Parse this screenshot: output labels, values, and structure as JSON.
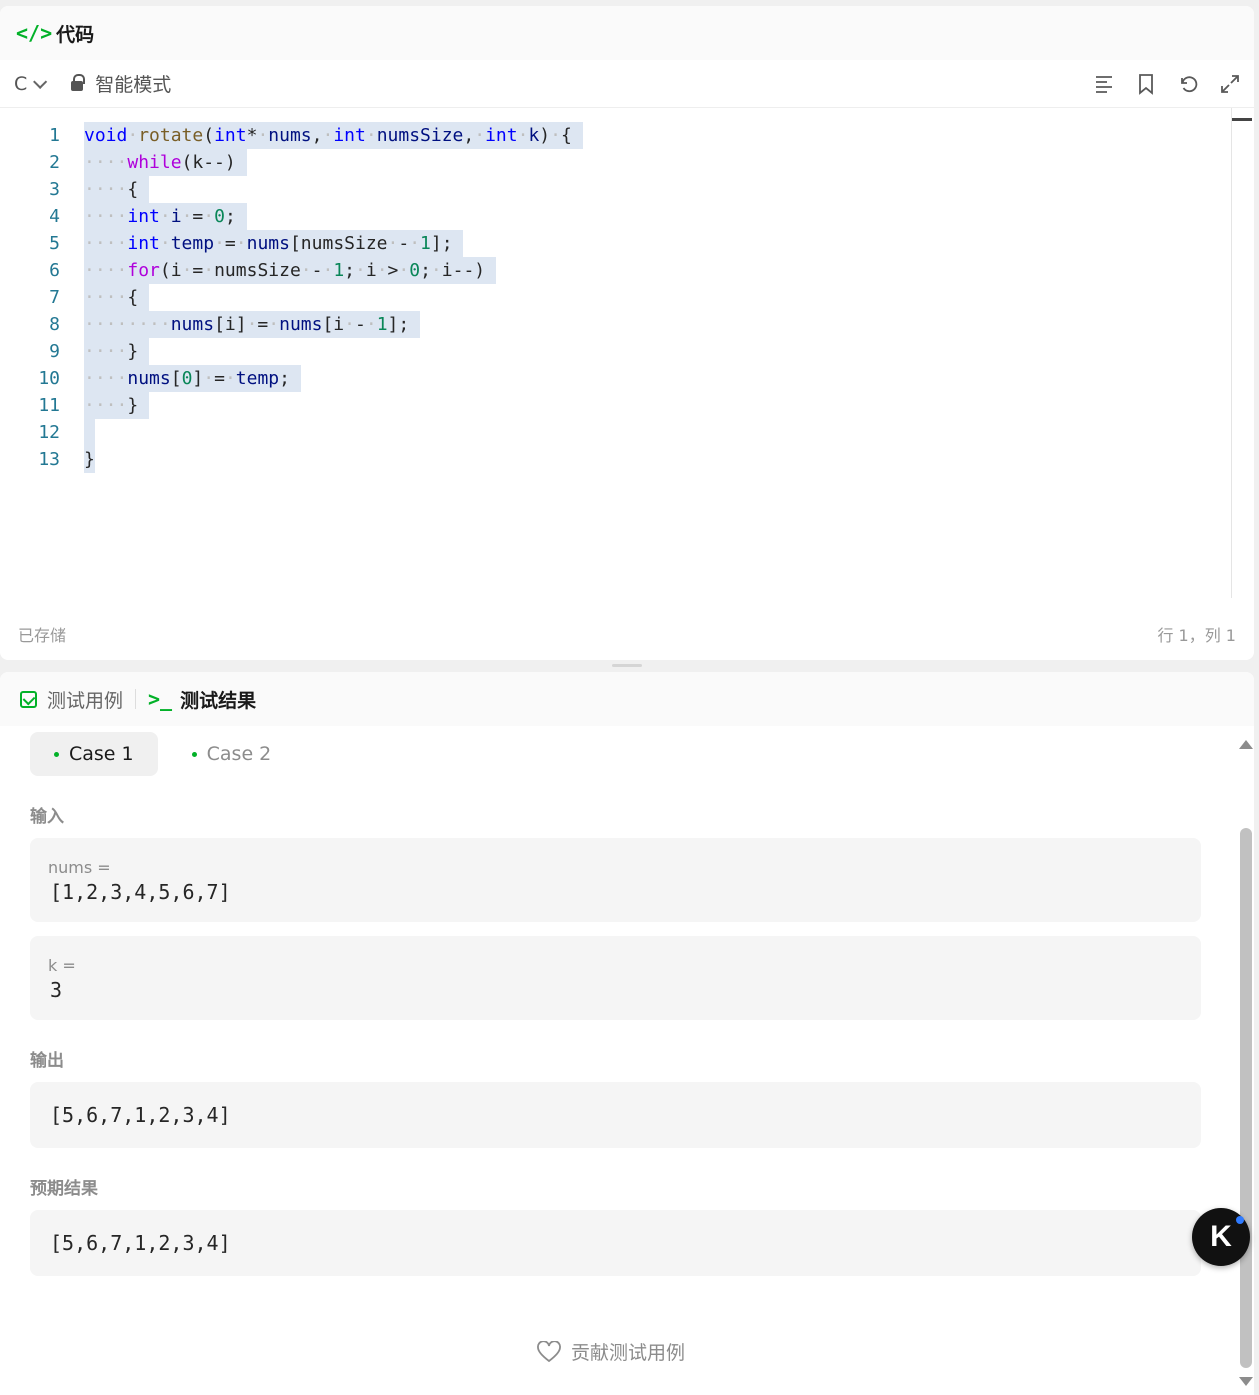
{
  "code_panel": {
    "title": "代码",
    "language": "C",
    "mode": "智能模式",
    "status_left": "已存储",
    "status_right": "行 1，列 1"
  },
  "test_panel": {
    "tab_cases": "测试用例",
    "tab_results": "测试结果",
    "cases": [
      "Case 1",
      "Case 2"
    ],
    "input_label": "输入",
    "inputs": [
      {
        "name": "nums =",
        "value": "[1,2,3,4,5,6,7]"
      },
      {
        "name": "k =",
        "value": "3"
      }
    ],
    "output_label": "输出",
    "output_value": "[5,6,7,1,2,3,4]",
    "expected_label": "预期结果",
    "expected_value": "[5,6,7,1,2,3,4]",
    "contribute_label": "贡献测试用例"
  },
  "badge_letter": "K",
  "colors": {
    "accent": "#02b128",
    "selection": "#dde6f2",
    "keyword": "#0000ff",
    "control": "#af00db",
    "number": "#098658"
  }
}
